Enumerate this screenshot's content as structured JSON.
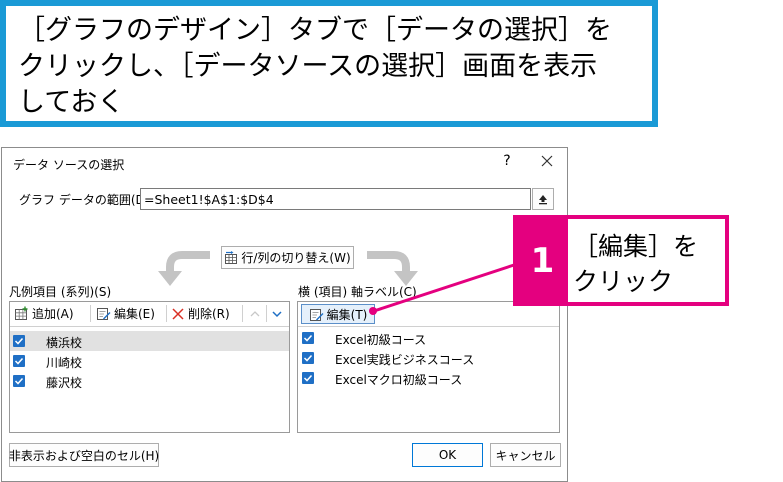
{
  "instruction": {
    "lines": [
      "［グラフのデザイン］タブで［データの選択］を",
      "クリックし、［データソースの選択］画面を表示",
      "しておく"
    ],
    "border_color": "#1a9ad6"
  },
  "dialog": {
    "title": "データ ソースの選択",
    "help_label": "?",
    "range": {
      "label": "グラフ データの範囲(D):",
      "value": "=Sheet1!$A$1:$D$4"
    },
    "switch_button": "行/列の切り替え(W)",
    "legend_entries": {
      "heading": "凡例項目 (系列)(S)",
      "add_button": "追加(A)",
      "edit_button": "編集(E)",
      "remove_button": "削除(R)",
      "items": [
        {
          "label": "横浜校",
          "checked": true,
          "selected": true
        },
        {
          "label": "川崎校",
          "checked": true,
          "selected": false
        },
        {
          "label": "藤沢校",
          "checked": true,
          "selected": false
        }
      ]
    },
    "axis_labels": {
      "heading": "横 (項目) 軸ラベル(C)",
      "edit_button": "編集(T)",
      "items": [
        {
          "label": "Excel初級コース",
          "checked": true
        },
        {
          "label": "Excel実践ビジネスコース",
          "checked": true
        },
        {
          "label": "Excelマクロ初級コース",
          "checked": true
        }
      ]
    },
    "hidden_cells_button": "非表示および空白のセル(H)",
    "ok_button": "OK",
    "cancel_button": "キャンセル"
  },
  "callout": {
    "step": "1",
    "lines": [
      "［編集］を",
      "クリック"
    ],
    "color": "#e4007f"
  },
  "icons": [
    "close-icon",
    "collapse-dialog-icon",
    "switch-row-column-icon",
    "add-icon",
    "edit-icon",
    "delete-icon",
    "move-up-icon",
    "move-down-icon",
    "checkbox-checked-icon"
  ],
  "colors": {
    "checkbox": "#1f6fc5",
    "selected_row": "#e1e1e1",
    "accent": "#e4007f",
    "frame": "#1a9ad6"
  }
}
